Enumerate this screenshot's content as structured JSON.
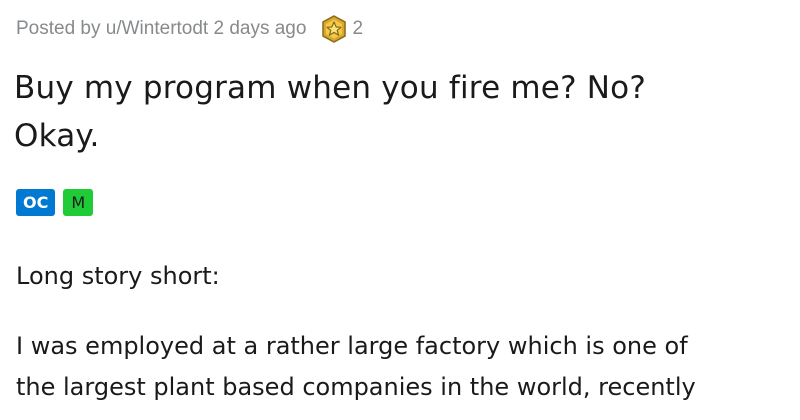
{
  "post": {
    "meta": {
      "posted_by": "Posted by u/Wintertodt 2 days ago",
      "award_icon": "gold-star-award-icon",
      "award_count": "2"
    },
    "title_line1": "Buy my program when you fire me? No?",
    "title_line2": "Okay.",
    "flairs": [
      {
        "label": "OC",
        "color": "#0079d3"
      },
      {
        "label": "M",
        "color": "#1fcc37"
      }
    ],
    "body": {
      "p1": "Long story short:",
      "p2_line1": "I was employed at a rather large factory which is one of",
      "p2_line2": "the largest plant based companies in the world, recently"
    }
  }
}
